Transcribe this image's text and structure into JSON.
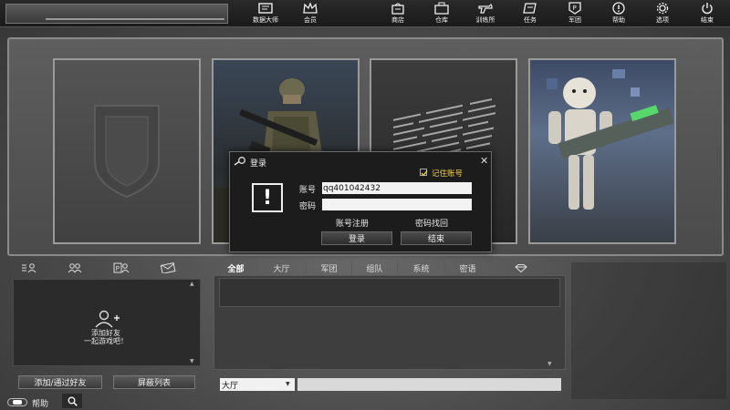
{
  "topnav": [
    {
      "label": "数据大师",
      "icon": "data-master-icon"
    },
    {
      "label": "会员",
      "icon": "crown-icon"
    },
    {
      "label": "商店",
      "icon": "shop-icon"
    },
    {
      "label": "仓库",
      "icon": "storage-icon"
    },
    {
      "label": "训练所",
      "icon": "training-icon"
    },
    {
      "label": "任务",
      "icon": "mission-icon"
    },
    {
      "label": "军团",
      "icon": "clan-icon"
    },
    {
      "label": "帮助",
      "icon": "help-icon"
    },
    {
      "label": "选项",
      "icon": "gear-icon"
    },
    {
      "label": "结束",
      "icon": "power-icon"
    }
  ],
  "login": {
    "title": "登录",
    "remember_label": "记住账号",
    "remember_checked": true,
    "account_label": "账号",
    "account_value": "qq401042432",
    "password_label": "密码",
    "register_label": "账号注册",
    "recover_label": "密码找回",
    "login_button": "登录",
    "exit_button": "结束",
    "close_glyph": "✕",
    "alert_glyph": "!"
  },
  "friends": {
    "empty_hint_line1": "添加好友",
    "empty_hint_line2": "一起游戏吧！",
    "add_button": "添加/通过好友",
    "block_button": "屏蔽列表"
  },
  "chat": {
    "tabs": [
      "全部",
      "大厅",
      "军团",
      "组队",
      "系统",
      "密语"
    ],
    "active_tab": "全部",
    "channel": "大厅"
  },
  "footer": {
    "help_label": "帮助"
  }
}
